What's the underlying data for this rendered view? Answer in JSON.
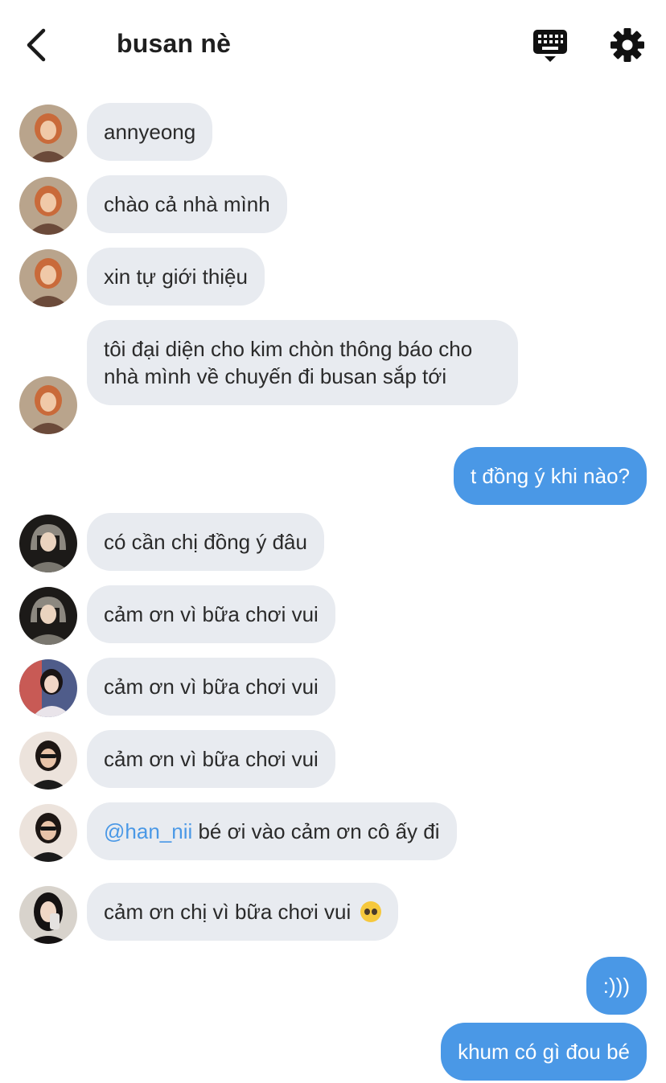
{
  "header": {
    "title": "busan nè",
    "back_icon": "chevron-left-icon",
    "keyboard_icon": "keyboard-icon",
    "settings_icon": "gear-icon"
  },
  "colors": {
    "incoming_bubble": "#e8ebf0",
    "outgoing_bubble": "#4a98e6",
    "mention": "#4a98e6"
  },
  "messages": [
    {
      "side": "in",
      "text": "annyeong"
    },
    {
      "side": "in",
      "text": "chào cả nhà mình"
    },
    {
      "side": "in",
      "text": "xin tự giới thiệu"
    },
    {
      "side": "in",
      "text": "tôi đại diện cho kim chòn thông báo cho nhà mình về chuyến đi busan sắp tới"
    },
    {
      "side": "out",
      "text": "t đồng ý khi nào?"
    },
    {
      "side": "in",
      "text": "có cần chị đồng ý đâu"
    },
    {
      "side": "in",
      "text": "cảm ơn vì bữa chơi vui"
    },
    {
      "side": "in",
      "text": "cảm ơn vì bữa chơi vui"
    },
    {
      "side": "in",
      "text": "cảm ơn vì bữa chơi vui"
    },
    {
      "side": "in",
      "mention": "@han_nii",
      "text": " bé ơi vào cảm ơn cô ấy đi"
    },
    {
      "side": "in",
      "text": "cảm ơn chị vì bữa chơi vui",
      "emoji": "pleading-face-emoji"
    },
    {
      "side": "out",
      "text": ":)))"
    },
    {
      "side": "out",
      "text": "khum có gì đou bé"
    }
  ]
}
